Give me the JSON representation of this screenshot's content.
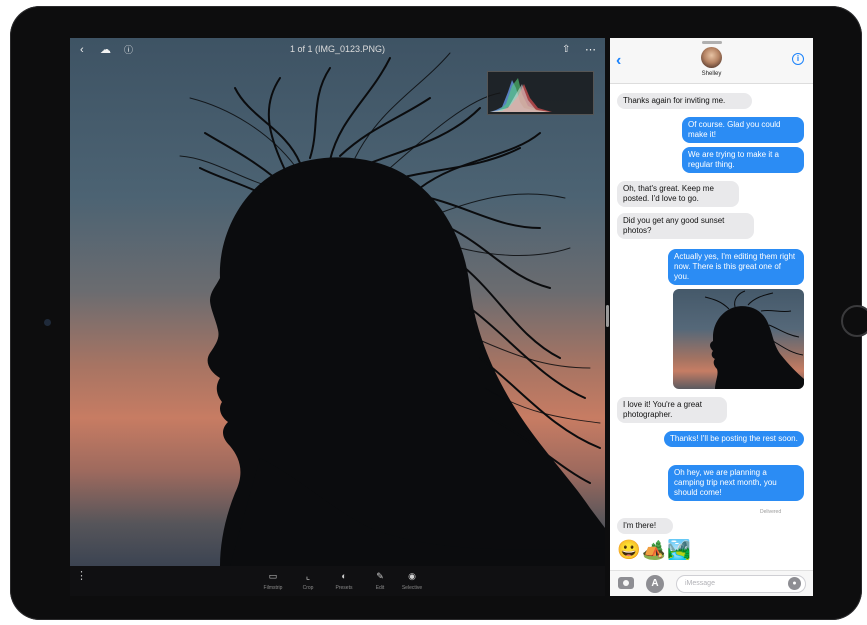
{
  "editor": {
    "title": "1 of 1 (IMG_0123.PNG)",
    "icons": {
      "back": "back-chevron-icon",
      "cloud": "cloud-icon",
      "info": "info-icon",
      "share": "share-icon",
      "more": "more-icon"
    },
    "tools": [
      {
        "label": "Filmstrip",
        "icon": "filmstrip-icon"
      },
      {
        "label": "Crop",
        "icon": "crop-icon"
      },
      {
        "label": "Presets",
        "icon": "presets-icon"
      },
      {
        "label": "Edit",
        "icon": "edit-icon"
      },
      {
        "label": "Selective",
        "icon": "selective-icon"
      }
    ]
  },
  "messages": {
    "contact_name": "Shelley",
    "thread": [
      {
        "from": "in",
        "text": "Thanks again for inviting me."
      },
      {
        "from": "out",
        "text": "Of course. Glad you could make it!"
      },
      {
        "from": "out",
        "text": "We are trying to make it a regular thing."
      },
      {
        "from": "in",
        "text": "Oh, that's great. Keep me posted. I'd love to go."
      },
      {
        "from": "in",
        "text": "Did you get any good sunset photos?"
      },
      {
        "from": "out",
        "text": "Actually yes, I'm editing them right now. There is this great one of you."
      },
      {
        "from": "in",
        "text": "I love it! You're a great photographer."
      },
      {
        "from": "out",
        "text": "Thanks! I'll be posting the rest soon."
      },
      {
        "from": "out",
        "text": "Oh hey, we are planning a camping trip next month, you should come!"
      },
      {
        "from": "in",
        "text": "I'm there!"
      }
    ],
    "delivered_label": "Delivered",
    "emojis": [
      "😀",
      "🏕️",
      "🏞️"
    ],
    "input_placeholder": "iMessage"
  },
  "colors": {
    "bubble_out": "#2b8cf4",
    "bubble_in": "#e9e9eb",
    "accent": "#1a82fb"
  }
}
